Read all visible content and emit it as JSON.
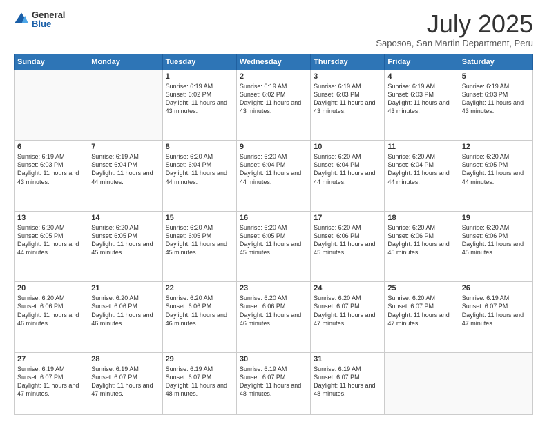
{
  "header": {
    "logo_general": "General",
    "logo_blue": "Blue",
    "month_title": "July 2025",
    "subtitle": "Saposoa, San Martin Department, Peru"
  },
  "days_of_week": [
    "Sunday",
    "Monday",
    "Tuesday",
    "Wednesday",
    "Thursday",
    "Friday",
    "Saturday"
  ],
  "weeks": [
    [
      {
        "day": "",
        "info": ""
      },
      {
        "day": "",
        "info": ""
      },
      {
        "day": "1",
        "info": "Sunrise: 6:19 AM\nSunset: 6:02 PM\nDaylight: 11 hours and 43 minutes."
      },
      {
        "day": "2",
        "info": "Sunrise: 6:19 AM\nSunset: 6:02 PM\nDaylight: 11 hours and 43 minutes."
      },
      {
        "day": "3",
        "info": "Sunrise: 6:19 AM\nSunset: 6:03 PM\nDaylight: 11 hours and 43 minutes."
      },
      {
        "day": "4",
        "info": "Sunrise: 6:19 AM\nSunset: 6:03 PM\nDaylight: 11 hours and 43 minutes."
      },
      {
        "day": "5",
        "info": "Sunrise: 6:19 AM\nSunset: 6:03 PM\nDaylight: 11 hours and 43 minutes."
      }
    ],
    [
      {
        "day": "6",
        "info": "Sunrise: 6:19 AM\nSunset: 6:03 PM\nDaylight: 11 hours and 43 minutes."
      },
      {
        "day": "7",
        "info": "Sunrise: 6:19 AM\nSunset: 6:04 PM\nDaylight: 11 hours and 44 minutes."
      },
      {
        "day": "8",
        "info": "Sunrise: 6:20 AM\nSunset: 6:04 PM\nDaylight: 11 hours and 44 minutes."
      },
      {
        "day": "9",
        "info": "Sunrise: 6:20 AM\nSunset: 6:04 PM\nDaylight: 11 hours and 44 minutes."
      },
      {
        "day": "10",
        "info": "Sunrise: 6:20 AM\nSunset: 6:04 PM\nDaylight: 11 hours and 44 minutes."
      },
      {
        "day": "11",
        "info": "Sunrise: 6:20 AM\nSunset: 6:04 PM\nDaylight: 11 hours and 44 minutes."
      },
      {
        "day": "12",
        "info": "Sunrise: 6:20 AM\nSunset: 6:05 PM\nDaylight: 11 hours and 44 minutes."
      }
    ],
    [
      {
        "day": "13",
        "info": "Sunrise: 6:20 AM\nSunset: 6:05 PM\nDaylight: 11 hours and 44 minutes."
      },
      {
        "day": "14",
        "info": "Sunrise: 6:20 AM\nSunset: 6:05 PM\nDaylight: 11 hours and 45 minutes."
      },
      {
        "day": "15",
        "info": "Sunrise: 6:20 AM\nSunset: 6:05 PM\nDaylight: 11 hours and 45 minutes."
      },
      {
        "day": "16",
        "info": "Sunrise: 6:20 AM\nSunset: 6:05 PM\nDaylight: 11 hours and 45 minutes."
      },
      {
        "day": "17",
        "info": "Sunrise: 6:20 AM\nSunset: 6:06 PM\nDaylight: 11 hours and 45 minutes."
      },
      {
        "day": "18",
        "info": "Sunrise: 6:20 AM\nSunset: 6:06 PM\nDaylight: 11 hours and 45 minutes."
      },
      {
        "day": "19",
        "info": "Sunrise: 6:20 AM\nSunset: 6:06 PM\nDaylight: 11 hours and 45 minutes."
      }
    ],
    [
      {
        "day": "20",
        "info": "Sunrise: 6:20 AM\nSunset: 6:06 PM\nDaylight: 11 hours and 46 minutes."
      },
      {
        "day": "21",
        "info": "Sunrise: 6:20 AM\nSunset: 6:06 PM\nDaylight: 11 hours and 46 minutes."
      },
      {
        "day": "22",
        "info": "Sunrise: 6:20 AM\nSunset: 6:06 PM\nDaylight: 11 hours and 46 minutes."
      },
      {
        "day": "23",
        "info": "Sunrise: 6:20 AM\nSunset: 6:06 PM\nDaylight: 11 hours and 46 minutes."
      },
      {
        "day": "24",
        "info": "Sunrise: 6:20 AM\nSunset: 6:07 PM\nDaylight: 11 hours and 47 minutes."
      },
      {
        "day": "25",
        "info": "Sunrise: 6:20 AM\nSunset: 6:07 PM\nDaylight: 11 hours and 47 minutes."
      },
      {
        "day": "26",
        "info": "Sunrise: 6:19 AM\nSunset: 6:07 PM\nDaylight: 11 hours and 47 minutes."
      }
    ],
    [
      {
        "day": "27",
        "info": "Sunrise: 6:19 AM\nSunset: 6:07 PM\nDaylight: 11 hours and 47 minutes."
      },
      {
        "day": "28",
        "info": "Sunrise: 6:19 AM\nSunset: 6:07 PM\nDaylight: 11 hours and 47 minutes."
      },
      {
        "day": "29",
        "info": "Sunrise: 6:19 AM\nSunset: 6:07 PM\nDaylight: 11 hours and 48 minutes."
      },
      {
        "day": "30",
        "info": "Sunrise: 6:19 AM\nSunset: 6:07 PM\nDaylight: 11 hours and 48 minutes."
      },
      {
        "day": "31",
        "info": "Sunrise: 6:19 AM\nSunset: 6:07 PM\nDaylight: 11 hours and 48 minutes."
      },
      {
        "day": "",
        "info": ""
      },
      {
        "day": "",
        "info": ""
      }
    ]
  ]
}
